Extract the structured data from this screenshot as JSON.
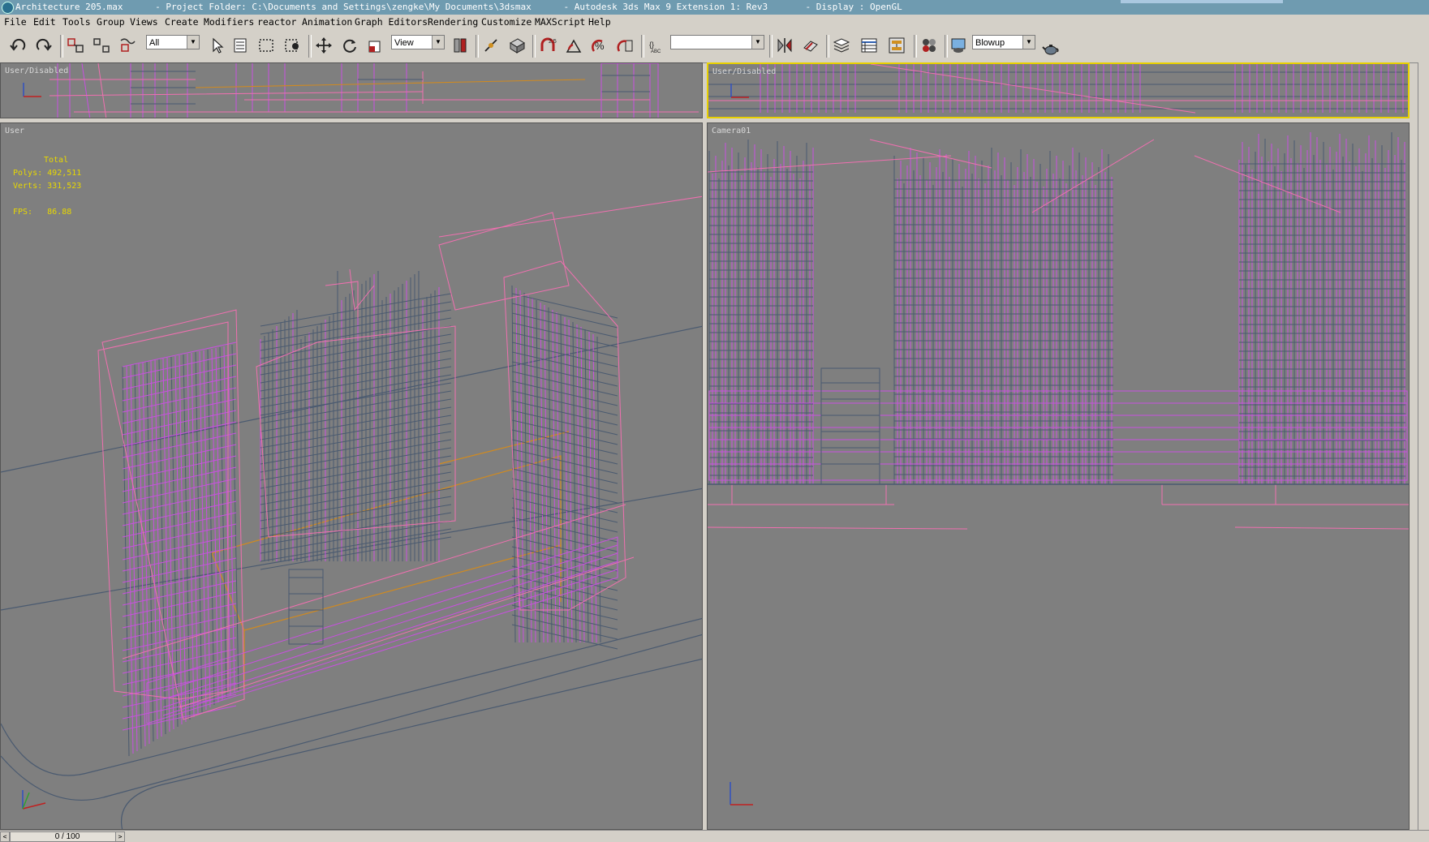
{
  "window": {
    "title": "Architecture 205.max      - Project Folder: C:\\Documents and Settings\\zengke\\My Documents\\3dsmax      - Autodesk 3ds Max 9 Extension 1: Rev3       - Display : OpenGL"
  },
  "menu": [
    "File",
    "Edit",
    "Tools",
    "Group",
    "Views",
    "Create",
    "Modifiers",
    "reactor",
    "Animation",
    "Graph Editors",
    "Rendering",
    "Customize",
    "MAXScript",
    "Help"
  ],
  "toolbar": {
    "selection_filter": "All",
    "reference_coord": "View",
    "named_selection": "",
    "render_type": "Blowup",
    "snap_label": "2.5"
  },
  "viewports": {
    "top_left": {
      "label": "User/Disabled"
    },
    "top_right": {
      "label": "User/Disabled"
    },
    "user": {
      "label": "User"
    },
    "camera": {
      "label": "Camera01"
    }
  },
  "stats": {
    "heading": "Total",
    "polys_label": "Polys:",
    "polys_value": "492,511",
    "verts_label": "Verts:",
    "verts_value": "331,523",
    "fps_label": "FPS:",
    "fps_value": "86.88"
  },
  "timeline": {
    "frame": "0 / 100",
    "prev": "<",
    "next": ">"
  },
  "colors": {
    "viewport_bg": "#7f7f7f",
    "wire_magenta": "#c850e0",
    "wire_pink": "#f070b0",
    "wire_slate": "#4a5a70",
    "wire_orange": "#d08a20",
    "active_border": "#e8d000",
    "stats_text": "#e8d800"
  }
}
